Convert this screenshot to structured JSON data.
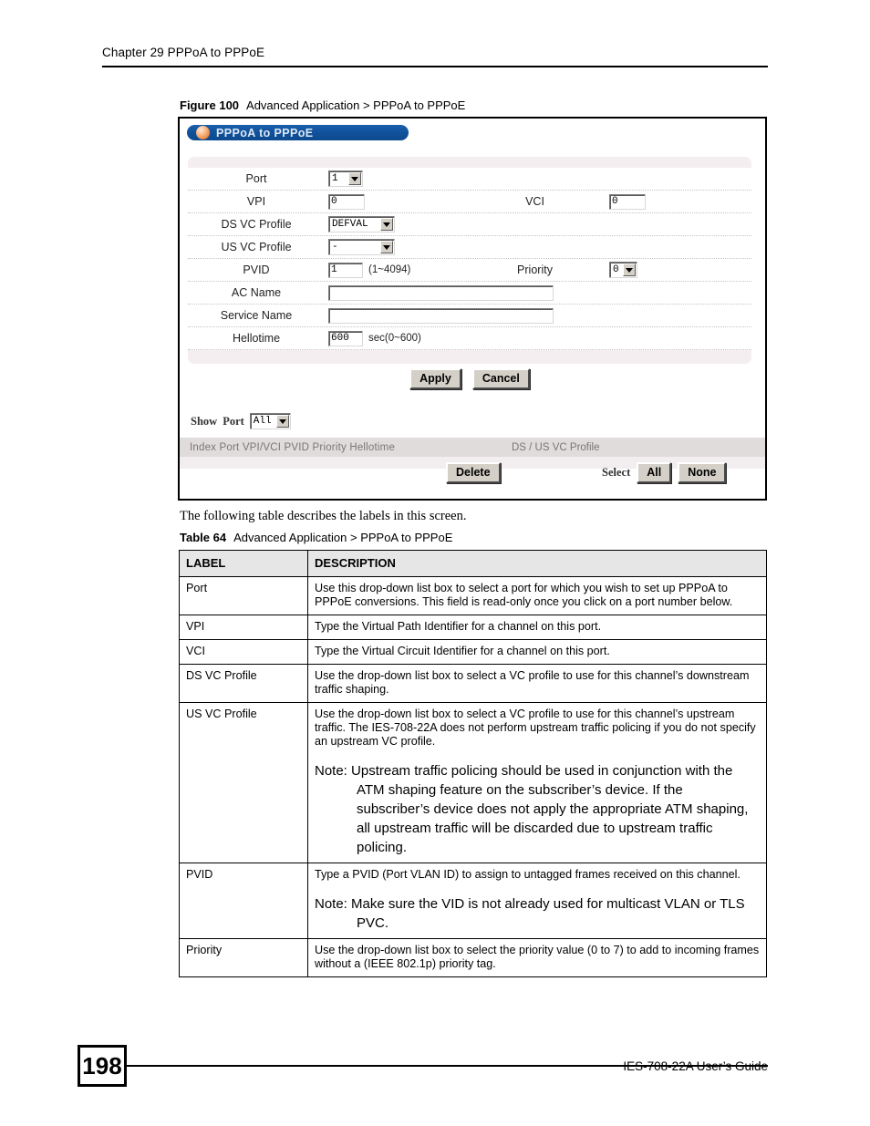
{
  "header": {
    "chapter": "Chapter 29 PPPoA to PPPoE"
  },
  "figure": {
    "number": "Figure 100",
    "caption": "Advanced Application > PPPoA to PPPoE"
  },
  "screen": {
    "title": "PPPoA to PPPoE",
    "fields": {
      "port_label": "Port",
      "port_value": "1",
      "vpi_label": "VPI",
      "vpi_value": "0",
      "vci_label": "VCI",
      "vci_value": "0",
      "ds_vc_profile_label": "DS VC Profile",
      "ds_vc_profile_value": "DEFVAL",
      "us_vc_profile_label": "US VC Profile",
      "us_vc_profile_value": "-",
      "pvid_label": "PVID",
      "pvid_value": "1",
      "pvid_hint": "(1~4094)",
      "priority_label": "Priority",
      "priority_value": "0",
      "ac_name_label": "AC Name",
      "ac_name_value": "",
      "service_name_label": "Service Name",
      "service_name_value": "",
      "hellotime_label": "Hellotime",
      "hellotime_value": "600",
      "hellotime_hint": "sec(0~600)"
    },
    "buttons": {
      "apply": "Apply",
      "cancel": "Cancel",
      "delete": "Delete",
      "select_all": "All",
      "select_none": "None"
    },
    "show_port": {
      "show_label": "Show",
      "port_label": "Port",
      "value": "All"
    },
    "list": {
      "columns_left": "Index Port VPI/VCI  PVID   Priority  Hellotime",
      "columns_right": "DS / US VC Profile",
      "select_label": "Select"
    }
  },
  "body_line": "The following table describes the labels in this screen.",
  "table": {
    "number": "Table 64",
    "caption": "Advanced Application > PPPoA to PPPoE",
    "headers": [
      "LABEL",
      "DESCRIPTION"
    ],
    "rows": [
      {
        "label": "Port",
        "description": "Use this drop-down list box to select a port for which you wish to set up PPPoA to PPPoE conversions. This field is read-only once you click on a port number below.",
        "note": ""
      },
      {
        "label": "VPI",
        "description": "Type the Virtual Path Identifier for a channel on this port.",
        "note": ""
      },
      {
        "label": "VCI",
        "description": "Type the Virtual Circuit Identifier for a channel on this port.",
        "note": ""
      },
      {
        "label": "DS VC Profile",
        "description": "Use the drop-down list box to select a VC profile to use for this channel’s downstream traffic shaping.",
        "note": ""
      },
      {
        "label": "US VC Profile",
        "description": "Use the drop-down list box to select a VC profile to use for this channel’s upstream traffic. The IES-708-22A does not perform upstream traffic policing if you do not specify an upstream VC profile.",
        "note": "Note: Upstream traffic policing should be used in conjunction with the ATM shaping feature on the subscriber’s device. If the subscriber’s device does not apply the appropriate ATM shaping, all upstream traffic will be discarded due to upstream traffic policing."
      },
      {
        "label": "PVID",
        "description": "Type a PVID (Port VLAN ID) to assign to untagged frames received on this channel.",
        "note": "Note: Make sure the VID is not already used for multicast VLAN or TLS PVC."
      },
      {
        "label": "Priority",
        "description": "Use the drop-down list box to select the priority value (0 to 7) to add to incoming frames without a (IEEE 802.1p) priority tag.",
        "note": ""
      }
    ]
  },
  "footer": {
    "page_number": "198",
    "guide": "IES-708-22A User’s Guide"
  },
  "colors": {
    "titlebar_blue": "#12529c",
    "orb_orange": "#e8833c",
    "panel_tint": "#f4eef1",
    "list_header_grey": "#e0dcdc",
    "table_header_grey": "#e6e6e6"
  }
}
